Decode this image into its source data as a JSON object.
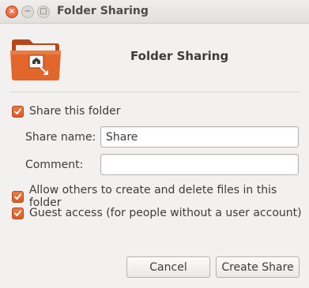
{
  "window": {
    "title": "Folder Sharing",
    "controls": {
      "close_glyph": "×",
      "minimize_glyph": "−",
      "maximize_glyph": "□"
    }
  },
  "header": {
    "icon": "folder-share-icon",
    "title": "Folder Sharing"
  },
  "share_checkbox": {
    "label": "Share this folder",
    "checked": true
  },
  "fields": {
    "share_name": {
      "label": "Share name:",
      "value": "Share",
      "placeholder": ""
    },
    "comment": {
      "label": "Comment:",
      "value": "",
      "placeholder": ""
    }
  },
  "options": [
    {
      "label": "Allow others to create and delete files in this folder",
      "checked": true
    },
    {
      "label": "Guest access (for people without a user account)",
      "checked": true
    }
  ],
  "buttons": {
    "cancel": "Cancel",
    "create": "Create Share"
  },
  "colors": {
    "accent": "#e2572b",
    "folder": "#d9581d",
    "background": "#f2f1f0"
  }
}
